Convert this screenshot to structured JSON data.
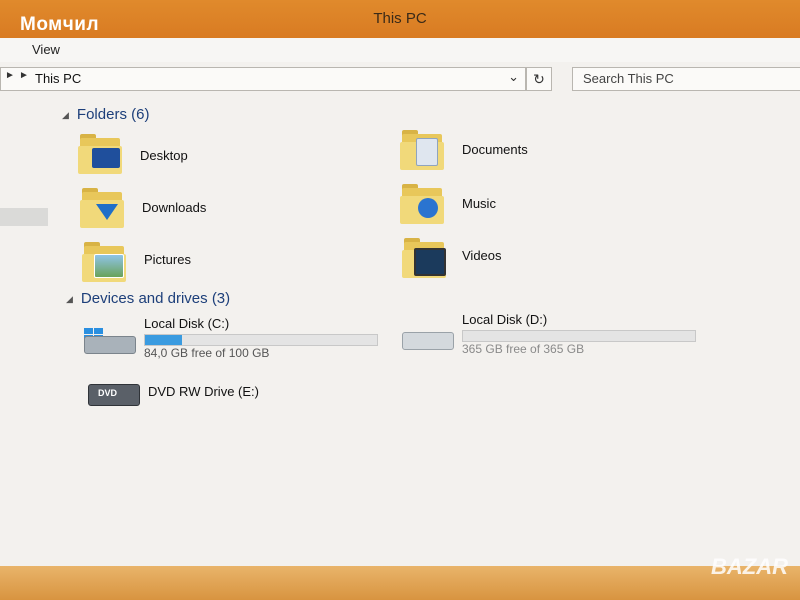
{
  "overlay": {
    "user_name": "Момчил",
    "watermark": "BAZAR"
  },
  "window": {
    "title": "This PC"
  },
  "ribbon": {
    "tabs": [
      "View"
    ]
  },
  "address": {
    "crumb": "This PC",
    "search_placeholder": "Search This PC",
    "back_arrow": "►",
    "dropdown_icon": "chevron-down-icon",
    "refresh_icon": "refresh-icon"
  },
  "folders_group": {
    "header": "Folders (6)",
    "items": [
      {
        "name": "Desktop",
        "icon": "desktop-folder-icon"
      },
      {
        "name": "Documents",
        "icon": "documents-folder-icon"
      },
      {
        "name": "Downloads",
        "icon": "downloads-folder-icon"
      },
      {
        "name": "Music",
        "icon": "music-folder-icon"
      },
      {
        "name": "Pictures",
        "icon": "pictures-folder-icon"
      },
      {
        "name": "Videos",
        "icon": "videos-folder-icon"
      }
    ]
  },
  "drives_group": {
    "header": "Devices and drives (3)",
    "drives": [
      {
        "name": "Local Disk (C:)",
        "free_text": "84,0 GB free of 100 GB",
        "used_fraction": 0.16,
        "icon": "windows-drive-icon"
      },
      {
        "name": "Local Disk (D:)",
        "free_text": "365 GB free of 365 GB",
        "used_fraction": 0.0,
        "icon": "hard-drive-icon"
      },
      {
        "name": "DVD RW Drive (E:)",
        "icon": "dvd-drive-icon"
      }
    ]
  },
  "colors": {
    "accent": "#d97b22",
    "header_text": "#1d3f7a",
    "progress": "#3a9be0"
  }
}
